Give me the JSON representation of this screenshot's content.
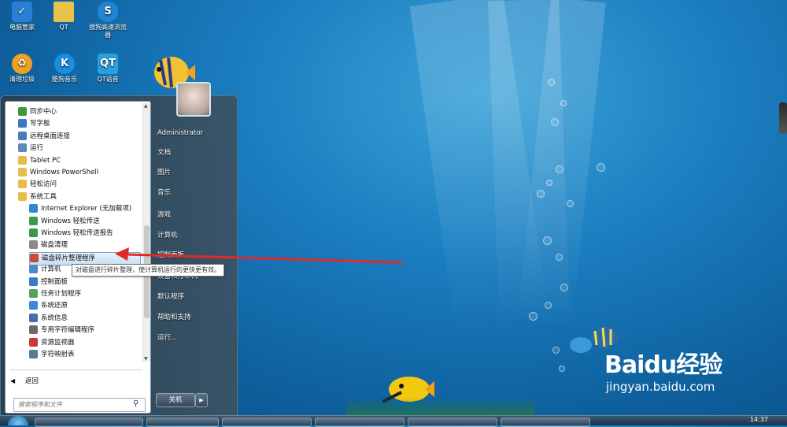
{
  "desktop": {
    "icons": [
      {
        "label": "电脑管家",
        "icon": "shield-icon",
        "color": "#2a7fd4"
      },
      {
        "label": "QT",
        "icon": "folder-icon",
        "color": "#e8c24a"
      },
      {
        "label": "搜狗高速浏览器",
        "icon": "browser-icon",
        "color": "#1f86d6"
      },
      {
        "label": "清理垃圾",
        "icon": "broom-icon",
        "color": "#f0a020"
      },
      {
        "label": "酷狗音乐",
        "icon": "music-icon",
        "color": "#1a8ee0"
      },
      {
        "label": "QT语音",
        "icon": "voice-icon",
        "color": "#2aa0e0"
      }
    ]
  },
  "start_menu": {
    "programs": [
      {
        "label": "同步中心",
        "icon": "sync-icon",
        "color": "#3a9a3a"
      },
      {
        "label": "写字板",
        "icon": "wordpad-icon",
        "color": "#3a78c8"
      },
      {
        "label": "远程桌面连接",
        "icon": "remote-desktop-icon",
        "color": "#4a7ab8"
      },
      {
        "label": "运行",
        "icon": "run-icon",
        "color": "#5a8ac0"
      },
      {
        "label": "Tablet PC",
        "icon": "folder-icon",
        "color": "#e6bd4b"
      },
      {
        "label": "Windows PowerShell",
        "icon": "folder-icon",
        "color": "#e6bd4b"
      },
      {
        "label": "轻松访问",
        "icon": "folder-icon",
        "color": "#e6bd4b"
      },
      {
        "label": "系统工具",
        "icon": "folder-icon",
        "color": "#e6bd4b"
      },
      {
        "label": "Internet Explorer (无加载项)",
        "icon": "ie-icon",
        "color": "#2a8ad8",
        "indent": true
      },
      {
        "label": "Windows 轻松传送",
        "icon": "transfer-icon",
        "color": "#3a9a4a",
        "indent": true
      },
      {
        "label": "Windows 轻松传送报告",
        "icon": "transfer-report-icon",
        "color": "#3a9a4a",
        "indent": true
      },
      {
        "label": "磁盘清理",
        "icon": "disk-cleanup-icon",
        "color": "#8a8a8a",
        "indent": true
      },
      {
        "label": "磁盘碎片整理程序",
        "icon": "defrag-icon",
        "color": "#c84a3a",
        "indent": true,
        "selected": true
      },
      {
        "label": "计算机",
        "icon": "computer-icon",
        "color": "#4a8ac8",
        "indent": true
      },
      {
        "label": "控制面板",
        "icon": "control-panel-icon",
        "color": "#3a7ac8",
        "indent": true
      },
      {
        "label": "任务计划程序",
        "icon": "task-scheduler-icon",
        "color": "#5aa05a",
        "indent": true
      },
      {
        "label": "系统还原",
        "icon": "system-restore-icon",
        "color": "#3a8ad8",
        "indent": true
      },
      {
        "label": "系统信息",
        "icon": "system-info-icon",
        "color": "#4a6aa8",
        "indent": true
      },
      {
        "label": "专用字符编辑程序",
        "icon": "char-editor-icon",
        "color": "#6a6a6a",
        "indent": true
      },
      {
        "label": "资源监视器",
        "icon": "resource-monitor-icon",
        "color": "#c83a3a",
        "indent": true
      },
      {
        "label": "字符映射表",
        "icon": "char-map-icon",
        "color": "#5a7a9a",
        "indent": true
      }
    ],
    "back_label": "返回",
    "search_placeholder": "搜索程序和文件",
    "right_items": [
      {
        "label": "Administrator"
      },
      {
        "label": "文档"
      },
      {
        "label": "图片"
      },
      {
        "label": "音乐"
      },
      {
        "label": "游戏"
      },
      {
        "label": "计算机"
      },
      {
        "label": "控制面板"
      },
      {
        "label": "设备和打印机"
      },
      {
        "label": "默认程序"
      },
      {
        "label": "帮助和支持"
      },
      {
        "label": "运行..."
      }
    ],
    "shutdown_label": "关机",
    "tooltip": "对磁盘进行碎片整理，使计算机运行的更快更有效。"
  },
  "taskbar": {
    "clock": "14:37"
  },
  "watermark": {
    "logo_text": "Baidu经验",
    "url": "jingyan.baidu.com"
  },
  "annotation": {
    "arrow_color": "#e02a2a"
  }
}
